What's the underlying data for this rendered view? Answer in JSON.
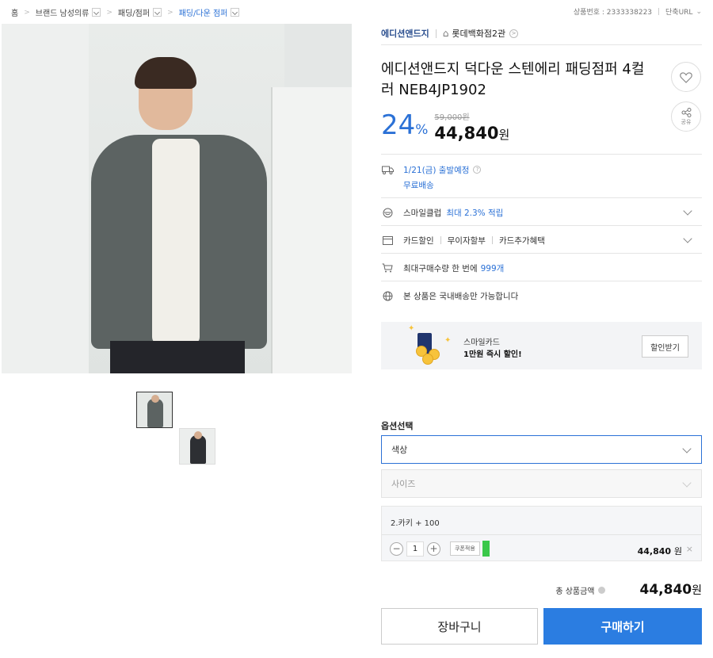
{
  "breadcrumb": {
    "items": [
      "홈",
      "브랜드 남성의류",
      "패딩/점퍼",
      "패딩/다운 점퍼"
    ]
  },
  "top_right": {
    "product_no": "상품번호 : 2333338223",
    "short_url": "단축URL"
  },
  "shop": {
    "brand": "에디션앤드지",
    "store": "롯데백화점2관"
  },
  "product": {
    "title": "에디션앤드지 덕다운 스텐에리 패딩점퍼 4컬러 NEB4JP1902",
    "discount_pct": "24",
    "pct_sign": "%",
    "original_price": "59,000원",
    "sale_price": "44,840",
    "won": "원",
    "share_label": "공유"
  },
  "delivery": {
    "date": "1/21(금) 출발예정",
    "fee": "무료배송"
  },
  "rows": {
    "smile_label": "스마일클럽",
    "smile_value": "최대 2.3% 적립",
    "card_discount": "카드할인",
    "installment": "무이자할부",
    "card_benefit": "카드추가혜택",
    "max_qty_prefix": "최대구매수량 한 번에",
    "max_qty_value": "999개",
    "domestic": "본 상품은 국내배송만 가능합니다"
  },
  "promo": {
    "line1": "스마일카드",
    "line2": "1만원 즉시 할인!",
    "button": "할인받기"
  },
  "options": {
    "title": "옵션선택",
    "color_placeholder": "색상",
    "size_placeholder": "사이즈",
    "selected_name": "2.카키 + 100",
    "quantity": "1",
    "coupon": "쿠폰적용",
    "line_amount": "44,840",
    "line_won": "원"
  },
  "total": {
    "label": "총 상품금액",
    "value": "44,840",
    "won": "원"
  },
  "actions": {
    "cart": "장바구니",
    "buy": "구매하기"
  },
  "colors": {
    "accent": "#2b71d6",
    "buy_button": "#2b7de1",
    "coupon_bar": "#3ac84a"
  }
}
